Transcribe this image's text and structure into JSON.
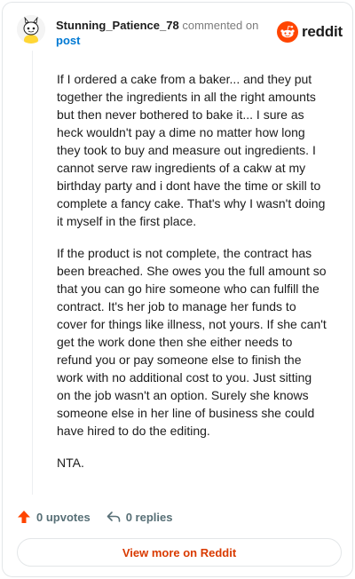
{
  "header": {
    "username": "Stunning_Patience_78",
    "action_text": "commented on",
    "post_link": "post",
    "logo_text": "reddit"
  },
  "comment": {
    "paragraphs": [
      "If I ordered a cake from a baker... and they put together the ingredients in all the right amounts but then never bothered to bake it... I sure as heck wouldn't pay a dime no matter how long they took to buy and measure out ingredients. I cannot serve raw ingredients of a cakw at my birthday party and i dont have the time or skill to complete a fancy cake. That's why I wasn't doing it myself in the first place.",
      "If the product is not complete, the contract has been breached. She owes you the full amount so that you can go hire someone who can fulfill the contract. It's her job to manage her funds to cover for things like illness, not yours. If she can't get the work done then she either needs to refund you or pay someone else to finish the work with no additional cost to you. Just sitting on the job wasn't an option. Surely she knows someone else in her line of business she could have hired to do the editing.",
      "NTA."
    ]
  },
  "footer": {
    "upvotes_label": "0 upvotes",
    "replies_label": "0 replies",
    "view_more_label": "View more on Reddit"
  },
  "colors": {
    "brand": "#ff4500",
    "link": "#0079d3",
    "view_more": "#d93a00"
  }
}
